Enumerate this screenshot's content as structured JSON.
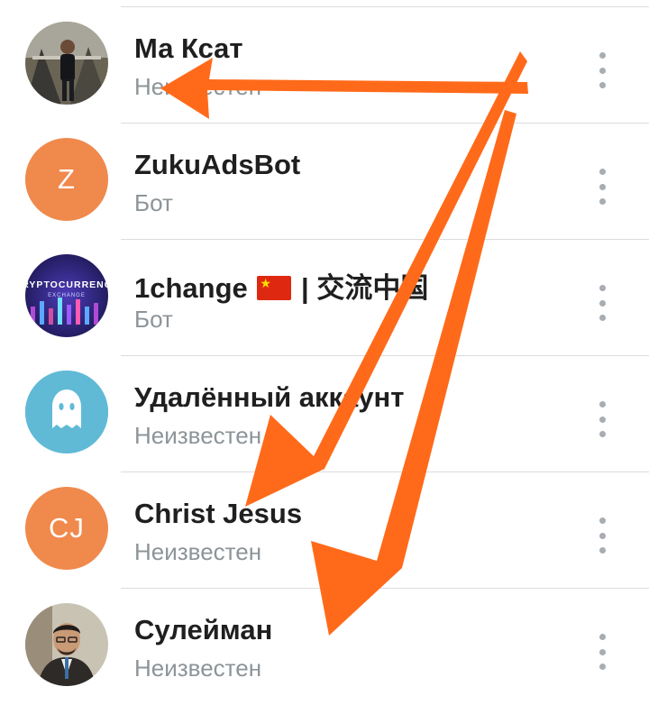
{
  "contacts": [
    {
      "name": "Ма Ксат",
      "status": "Неизвестен",
      "avatar": "photo"
    },
    {
      "name": "ZukuAdsBot",
      "status": "Бот",
      "avatar_initials": "Z",
      "avatar_color": "#f0894c"
    },
    {
      "name_before": "1change",
      "name_after": "| 交流中国",
      "status": "Бот",
      "avatar_text_top": "CRYPTOCURRENCY",
      "avatar_text_bottom": "EXCHANGE",
      "flag": "china-flag"
    },
    {
      "name": "Удалённый аккаунт",
      "status": "Неизвестен",
      "avatar": "ghost",
      "avatar_color": "#60bad6"
    },
    {
      "name": "Christ Jesus",
      "status": "Неизвестен",
      "avatar_initials": "CJ",
      "avatar_color": "#f0894c"
    },
    {
      "name": "Сулейман",
      "status": "Неизвестен",
      "avatar": "photo"
    }
  ],
  "colors": {
    "annotation_arrows": "#ff6a1a",
    "divider": "#dcdcdc",
    "status_text": "#8d9499",
    "menu_dots": "#a7adb2"
  },
  "icons": [
    "more-vert-icon",
    "ghost-icon",
    "china-flag"
  ]
}
